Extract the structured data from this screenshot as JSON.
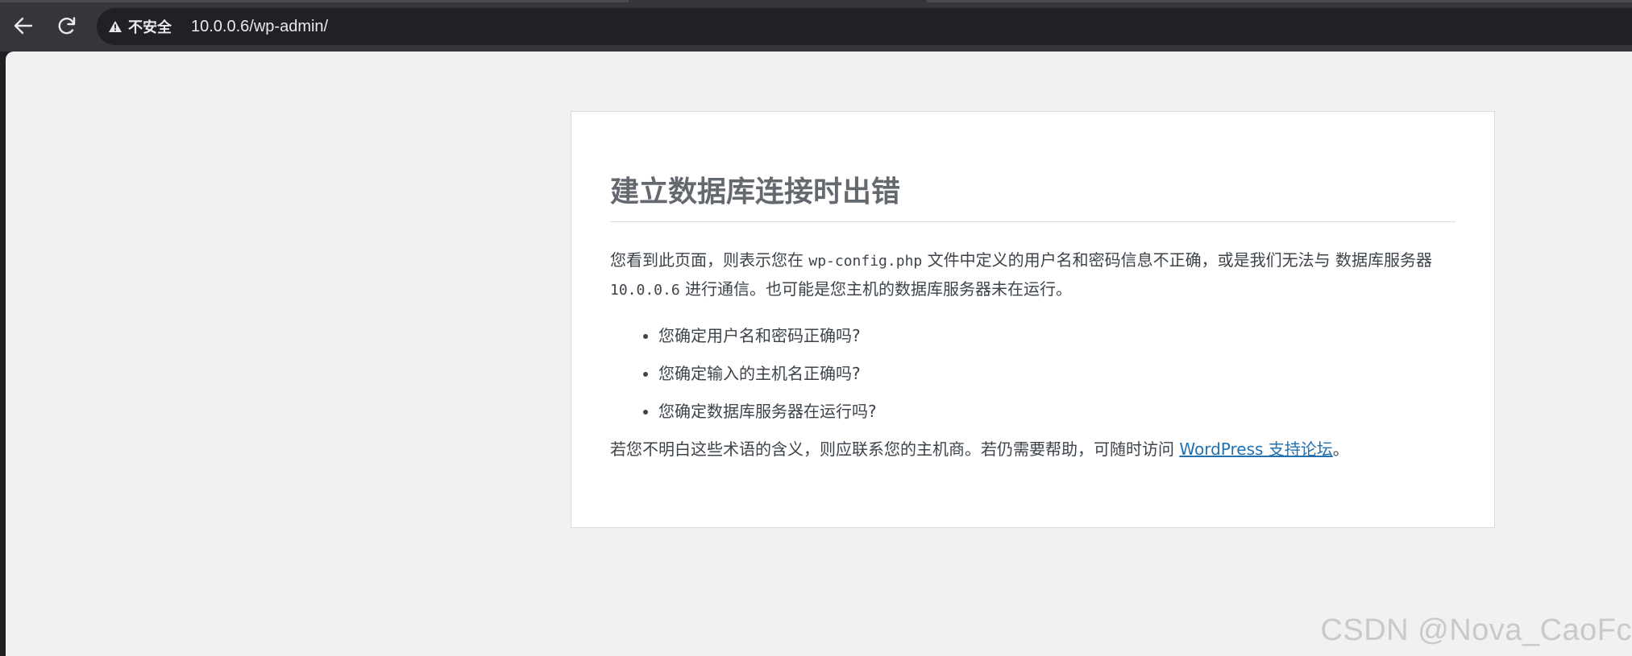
{
  "browser": {
    "back_icon": "arrow-left-icon",
    "reload_icon": "reload-icon",
    "security_icon": "warning-triangle-icon",
    "security_label": "不安全",
    "url": "10.0.0.6/wp-admin/"
  },
  "error": {
    "title": "建立数据库连接时出错",
    "intro_1": "您看到此页面，则表示您在 ",
    "intro_code_1": "wp-config.php",
    "intro_2": " 文件中定义的用户名和密码信息不正确，或是我们无法与 数据库服务器 ",
    "intro_code_2": "10.0.0.6",
    "intro_3": " 进行通信。也可能是您主机的数据库服务器未在运行。",
    "checks": [
      "您确定用户名和密码正确吗?",
      "您确定输入的主机名正确吗?",
      "您确定数据库服务器在运行吗?"
    ],
    "footer_text": "若您不明白这些术语的含义，则应联系您的主机商。若仍需要帮助，可随时访问 ",
    "footer_link": "WordPress 支持论坛",
    "footer_end": "。"
  },
  "watermark": "CSDN @Nova_CaoFc",
  "colors": {
    "chrome_bg": "#35363a",
    "omnibox_bg": "#202124",
    "page_bg": "#f1f1f1",
    "card_bg": "#ffffff",
    "title_color": "#646970",
    "link_color": "#2271b1"
  }
}
